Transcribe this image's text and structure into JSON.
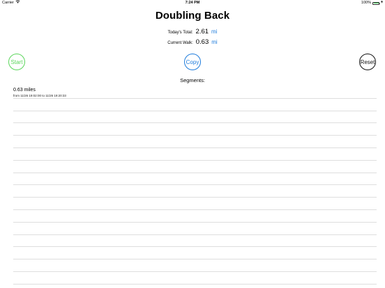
{
  "status_bar": {
    "carrier": "Carrier",
    "time": "7:24 PM",
    "battery": "100%",
    "battery_level": 1.0
  },
  "app": {
    "title": "Doubling Back"
  },
  "stats": {
    "today_label": "Today's Total:",
    "today_value": "2.61",
    "today_unit": "mi",
    "walk_label": "Current Walk:",
    "walk_value": "0.63",
    "walk_unit": "mi"
  },
  "buttons": {
    "start": "Start",
    "copy": "Copy",
    "reset": "Reset"
  },
  "segments": {
    "label": "Segments:",
    "items": [
      {
        "distance": "0.63 miles",
        "range": "from 11/26 19:02:00 to 11/26 19:20:33"
      }
    ],
    "empty_rows": 15
  },
  "colors": {
    "start": "#5bd65b",
    "copy": "#1e7cdc",
    "reset": "#111111",
    "unit": "#1e7cdc"
  }
}
